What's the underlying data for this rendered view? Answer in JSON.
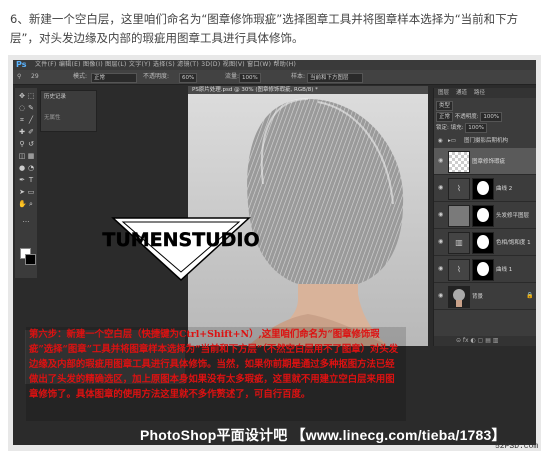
{
  "article": {
    "step_text": "6、新建一个空白层，这里咱们命名为“图章修饰瑕疵”选择图章工具并将图章样本选择为“当前和下方层”，对头发边缘及内部的瑕疵用图章工具进行具体修饰。"
  },
  "ps": {
    "app_logo": "Ps",
    "menus": "文件(F)  编辑(E)  图像(I)  图层(L)  文字(Y)  选择(S)  滤镜(T)  3D(D)  视图(V)  窗口(W)  帮助(H)",
    "options": {
      "size": "29",
      "mode_label": "模式:",
      "mode_value": "正常",
      "opacity_label": "不透明度:",
      "opacity_value": "60%",
      "flow_label": "流量:",
      "flow_value": "100%",
      "sample_label": "样本:",
      "sample_value": "当前和下方图层"
    },
    "history": {
      "tab": "历史记录",
      "item": "无属性"
    },
    "doc_tab": "PS原片处理.psd @ 30% (图章修饰瑕疵, RGB/8) *",
    "logo_text": "TUMENSTUDIO",
    "layers": {
      "tabs": [
        "图层",
        "通道",
        "路径"
      ],
      "kind": "类型",
      "blend_mode": "正常",
      "opacity_label": "不透明度:",
      "opacity_value": "100%",
      "lock_label": "锁定:",
      "fill_label": "填充:",
      "fill_value": "100%",
      "group_name": "图门摄影后期机构",
      "items": [
        {
          "name": "图章修饰瑕疵",
          "selected": true
        },
        {
          "name": "曲线 2",
          "selected": false
        },
        {
          "name": "头发修平图层",
          "selected": false
        },
        {
          "name": "色相/饱和度 1",
          "selected": false
        },
        {
          "name": "曲线 1",
          "selected": false
        },
        {
          "name": "背景",
          "selected": false
        }
      ],
      "bottom_icons": "⊝ fx ◐ ▢ ▤ ▥"
    }
  },
  "instructions": {
    "text": "第六步：新建一个空白层（快捷键为Ctrl+Shift+N）,这里咱们命名为“图章修饰瑕疵”选择“图章”工具并将图章样本选择为“当前和下方层”（不然空白层用不了图章）对头发边缘及内部的瑕疵用图章工具进行具体修饰。当然，如果你前期是通过多种抠图方法已经做出了头发的精确选区，加上原图本身如果没有太多瑕疵，这里就不用建立空白层来用图章修饰了。具体图章的使用方法这里就不多作赘述了，可自行百度。"
  },
  "watermark": "PhotoShop平面设计吧 【www.linecg.com/tieba/1783】",
  "site_tag": "52PSD.com"
}
